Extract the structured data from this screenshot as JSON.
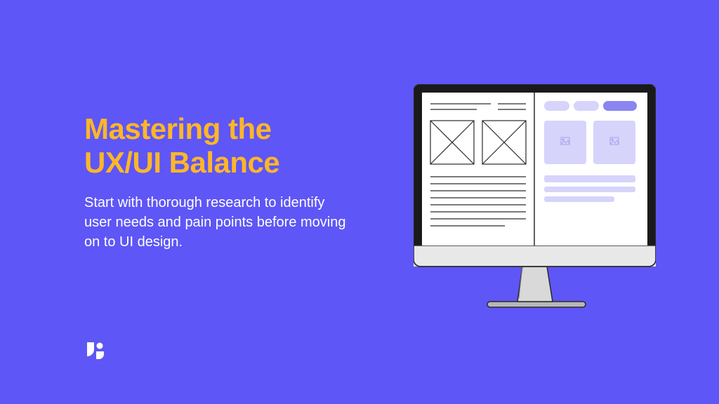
{
  "title_line1": "Mastering the",
  "title_line2": "UX/UI Balance",
  "subtitle": "Start with thorough research to identify user needs and pain points before moving on to UI design.",
  "colors": {
    "background": "#5E56F6",
    "title": "#FFB629",
    "text": "#ffffff",
    "accent_light": "#C9C8F6",
    "accent_mid": "#8A85F0"
  }
}
